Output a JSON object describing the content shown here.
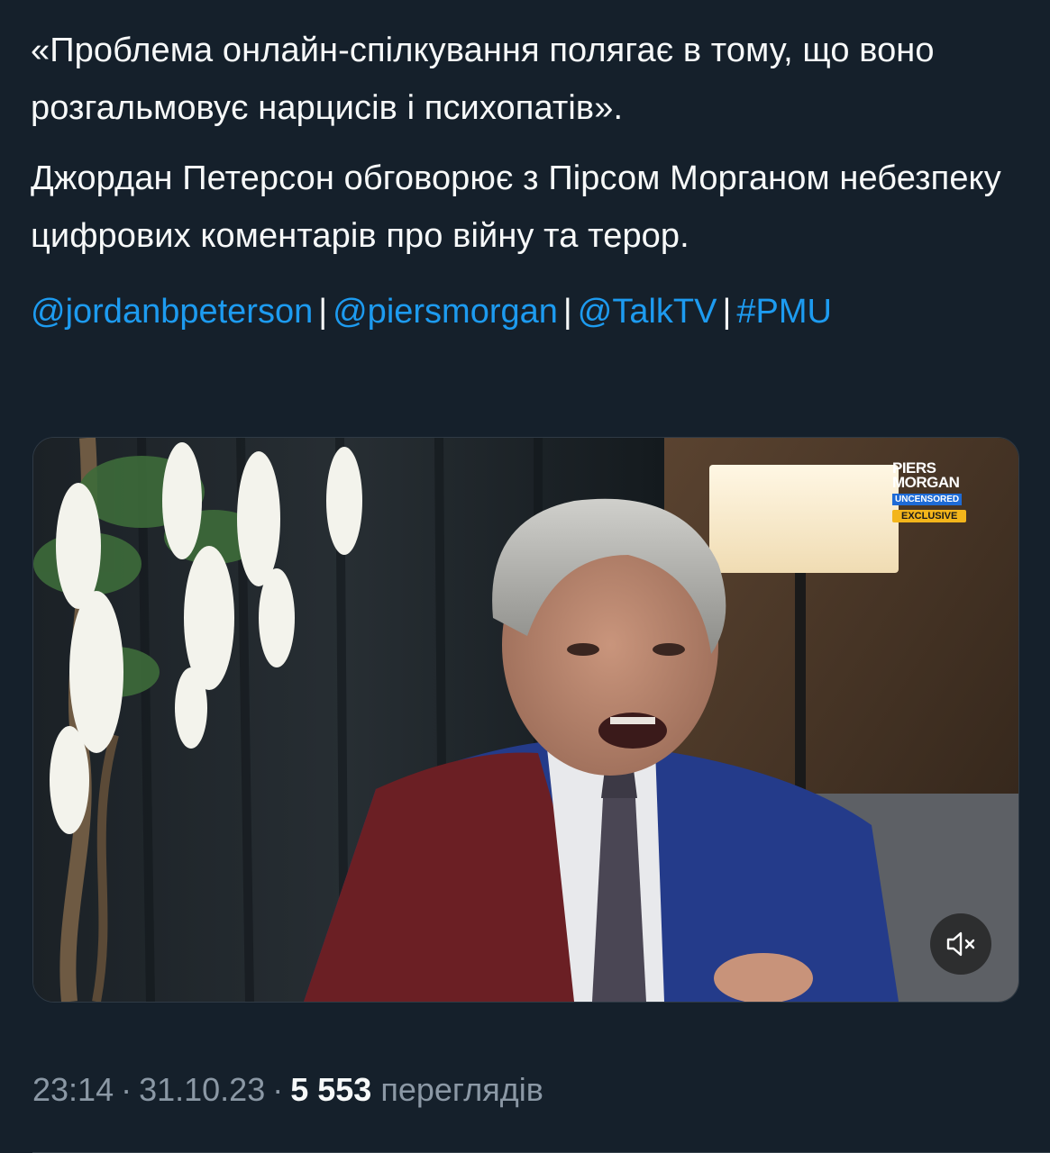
{
  "tweet": {
    "paragraph1": "«Проблема онлайн-спілкування полягає в тому, що воно розгальмовує нарцисів і психопатів».",
    "paragraph2": "Джордан Петерсон обговорює з Пірсом Морганом небезпеку цифрових коментарів про війну та терор.",
    "mentions": [
      "@jordanbpeterson",
      "@piersmorgan",
      "@TalkTV",
      "#PMU"
    ],
    "separator": "|"
  },
  "media": {
    "logo_line1": "PIERS",
    "logo_line2": "MORGAN",
    "logo_line3": "UNCENSORED",
    "logo_badge": "EXCLUSIVE",
    "mute_icon": "volume-muted-icon"
  },
  "meta": {
    "time": "23:14",
    "date": "31.10.23",
    "views_count": "5 553",
    "views_label": "переглядів",
    "dot": "·"
  },
  "colors": {
    "background": "#15202b",
    "text": "#f7f9f9",
    "link": "#1d9bf0",
    "secondary": "#8b98a5"
  }
}
